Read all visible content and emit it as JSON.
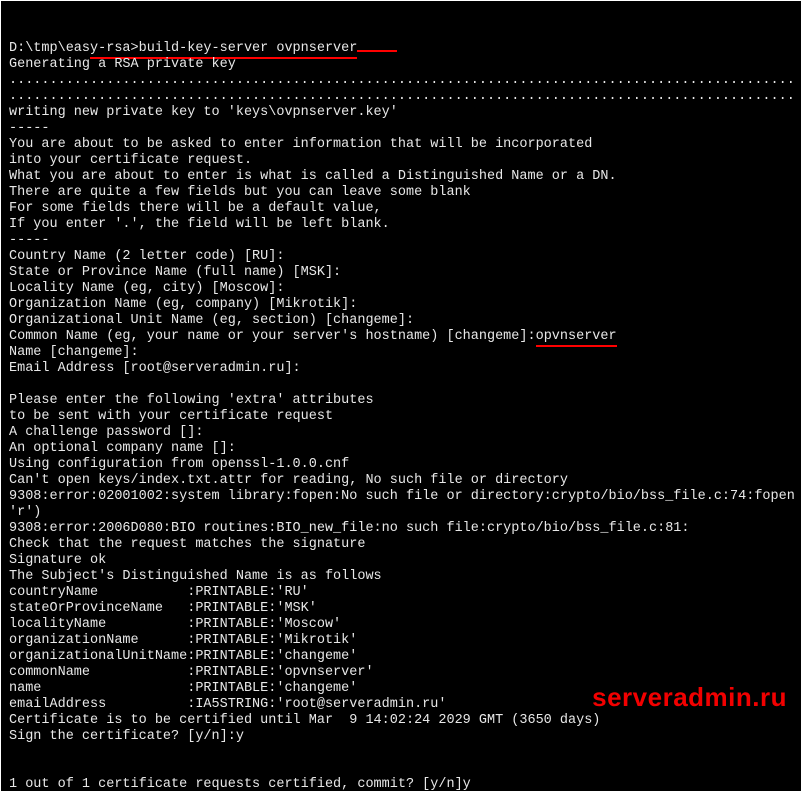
{
  "term": {
    "prompt_prefix": "D:\\tmp\\eas",
    "prompt_ul": "y-rsa>build-key-server ovpnserver",
    "lines1": [
      "Generating a RSA private key",
      ".................................................................................................",
      ".................................................................................................",
      "writing new private key to 'keys\\ovpnserver.key'",
      "-----",
      "You are about to be asked to enter information that will be incorporated",
      "into your certificate request.",
      "What you are about to enter is what is called a Distinguished Name or a DN.",
      "There are quite a few fields but you can leave some blank",
      "For some fields there will be a default value,",
      "If you enter '.', the field will be left blank.",
      "-----",
      "Country Name (2 letter code) [RU]:",
      "State or Province Name (full name) [MSK]:",
      "Locality Name (eg, city) [Moscow]:",
      "Organization Name (eg, company) [Mikrotik]:",
      "Organizational Unit Name (eg, section) [changeme]:"
    ],
    "cn_prefix": "Common Name (eg, your name or your server's hostname) [changeme]:",
    "cn_input": "opvnserver",
    "lines2": [
      "Name [changeme]:",
      "Email Address [root@serveradmin.ru]:",
      "",
      "Please enter the following 'extra' attributes",
      "to be sent with your certificate request",
      "A challenge password []:",
      "An optional company name []:",
      "Using configuration from openssl-1.0.0.cnf",
      "Can't open keys/index.txt.attr for reading, No such file or directory",
      "9308:error:02001002:system library:fopen:No such file or directory:crypto/bio/bss_file.c:74:fopen",
      "'r')",
      "9308:error:2006D080:BIO routines:BIO_new_file:no such file:crypto/bio/bss_file.c:81:",
      "Check that the request matches the signature",
      "Signature ok",
      "The Subject's Distinguished Name is as follows",
      "countryName           :PRINTABLE:'RU'",
      "stateOrProvinceName   :PRINTABLE:'MSK'",
      "localityName          :PRINTABLE:'Moscow'",
      "organizationName      :PRINTABLE:'Mikrotik'",
      "organizationalUnitName:PRINTABLE:'changeme'",
      "commonName            :PRINTABLE:'opvnserver'",
      "name                  :PRINTABLE:'changeme'",
      "emailAddress          :IA5STRING:'root@serveradmin.ru'",
      "Certificate is to be certified until Mar  9 14:02:24 2029 GMT (3650 days)",
      "Sign the certificate? [y/n]:y",
      "",
      "",
      "1 out of 1 certificate requests certified, commit? [y/n]y"
    ]
  },
  "watermark": "serveradmin.ru"
}
